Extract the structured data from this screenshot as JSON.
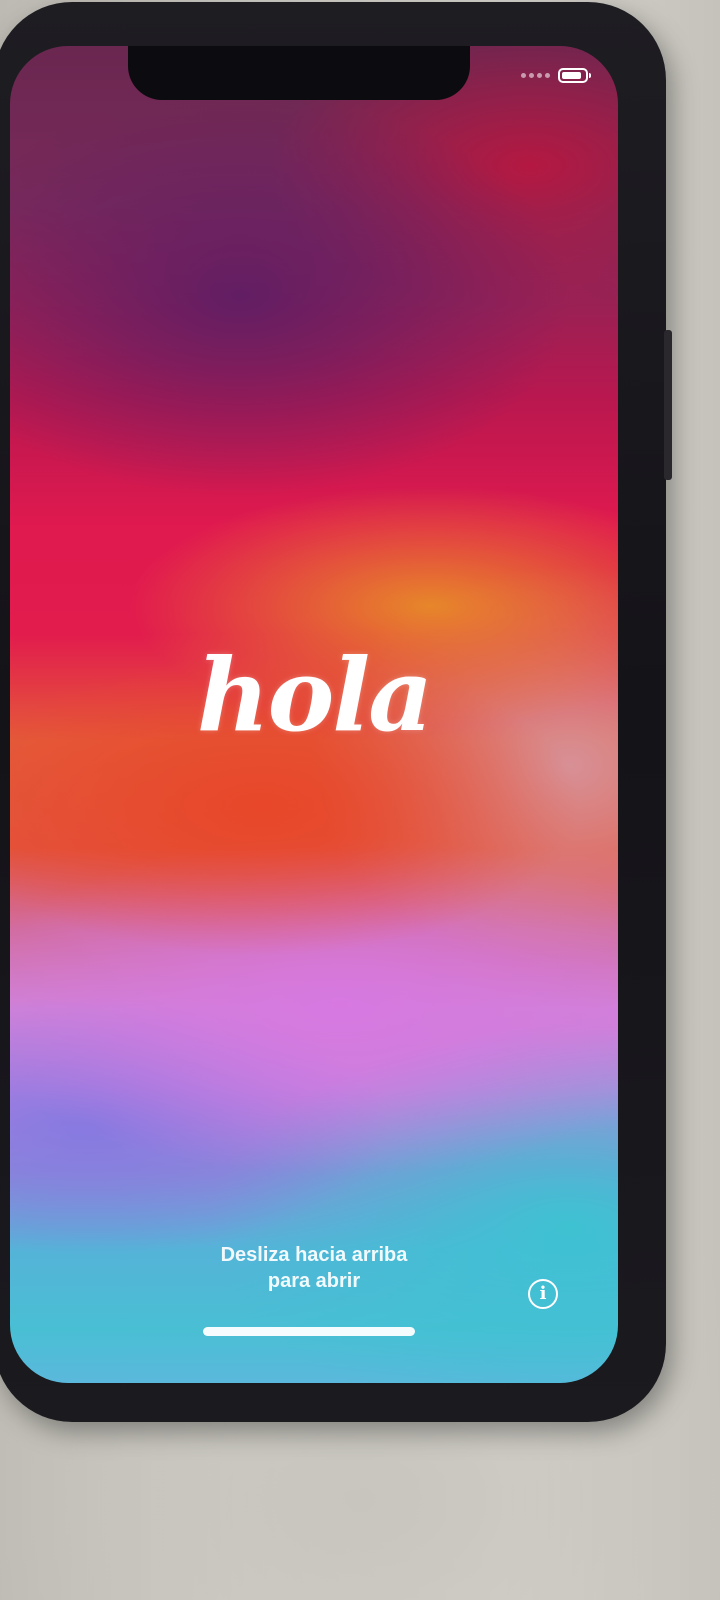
{
  "status_bar": {
    "signal_icon": "signal-dots-icon",
    "battery_icon": "battery-icon",
    "battery_level": 0.85
  },
  "greeting": {
    "text": "hola"
  },
  "swipe_hint": {
    "line1": "Desliza hacia arriba",
    "line2": "para abrir"
  },
  "info_button": {
    "icon": "info-icon",
    "glyph": "i"
  },
  "colors": {
    "text": "#ffffff",
    "wallpaper_top": "#6a2750",
    "wallpaper_mid": "#e21c4d",
    "wallpaper_orange": "#e78c28",
    "wallpaper_pink": "#d778e1",
    "wallpaper_bottom": "#49bfd4"
  }
}
